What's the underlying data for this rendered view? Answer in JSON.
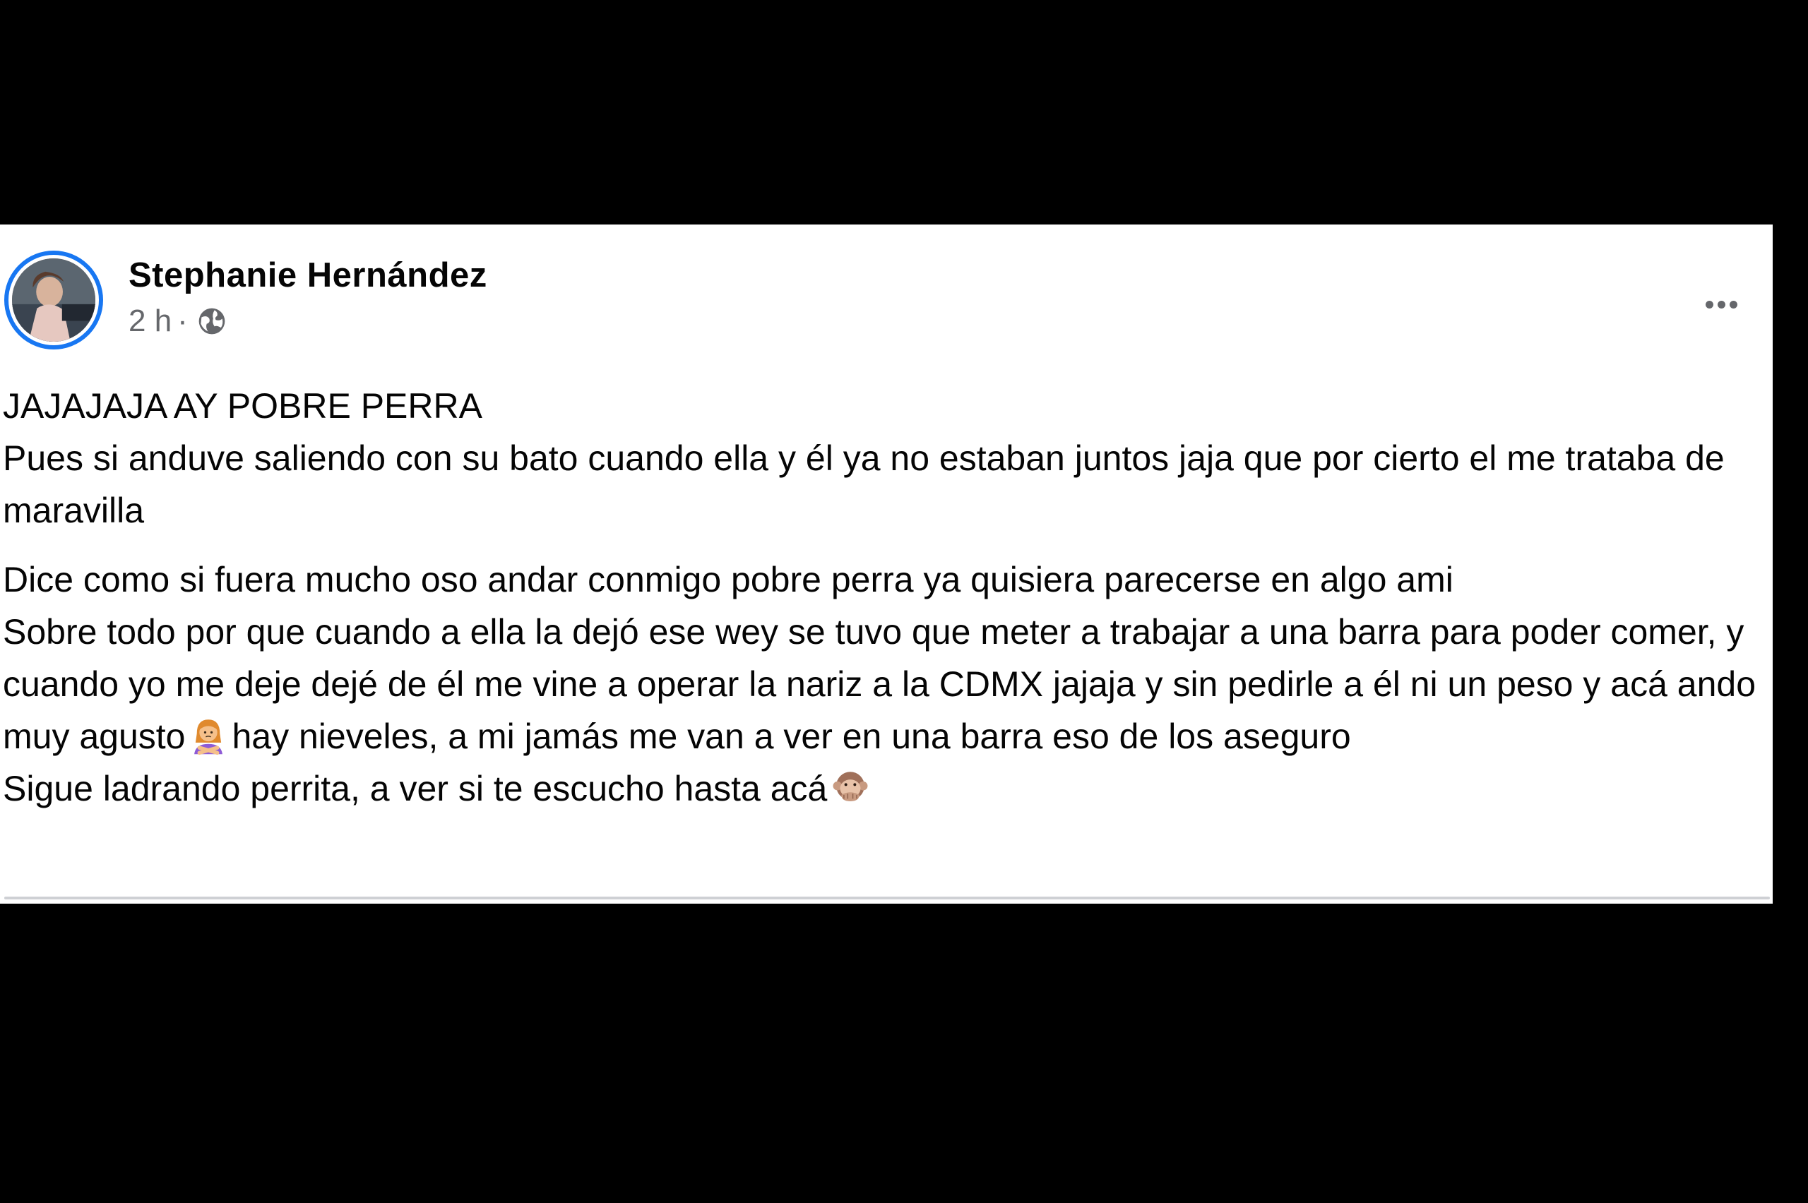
{
  "post": {
    "author": {
      "name": "Stephanie Hernández",
      "avatar_icon": "profile-photo"
    },
    "meta": {
      "time": "2 h",
      "separator": "·",
      "privacy_icon": "globe-icon"
    },
    "more_icon": "ellipsis-icon",
    "paragraphs": [
      {
        "lines": [
          "JAJAJAJA AY POBRE PERRA",
          "Pues si anduve saliendo con su bato cuando ella y él ya no estaban juntos jaja que por cierto el me trataba de maravilla"
        ]
      },
      {
        "lines": [
          "Dice como si fuera mucho oso andar conmigo pobre perra ya quisiera parecerse en algo ami",
          "Sobre todo por que cuando a ella la dejó ese wey se tuvo que meter a trabajar a una barra para poder comer, y cuando yo me deje dejé de él me vine a operar la nariz a la CDMX jajaja y sin pedirle a él ni un peso y acá ando muy agusto",
          "hay nieveles, a mi jamás me van a ver en una barra eso de los aseguro",
          "Sigue ladrando perrita, a ver si te escucho hasta acá"
        ]
      }
    ],
    "emoji_1": "person-gesturing-no-emoji",
    "emoji_2": "speak-no-evil-monkey-emoji",
    "colors": {
      "accent_ring": "#1877f2",
      "text_primary": "#050505",
      "text_secondary": "#65676b",
      "background": "#ffffff",
      "frame": "#000000"
    }
  }
}
